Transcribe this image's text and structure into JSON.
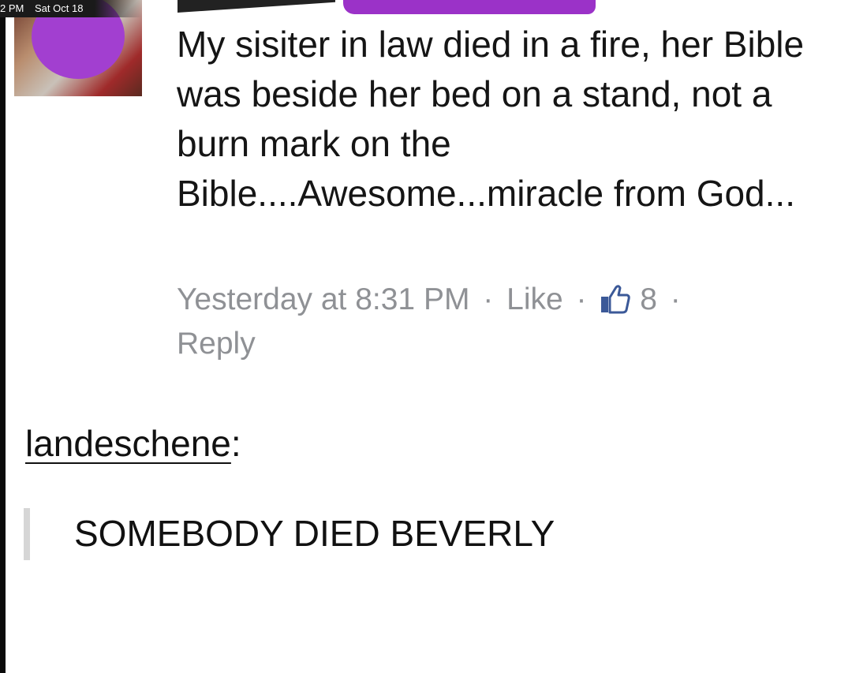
{
  "status_bar": {
    "time": "2 PM",
    "date": "Sat Oct 18"
  },
  "facebook_comment": {
    "body": "My sisiter in law died in a fire, her Bible was beside her bed on a stand, not a burn mark on the Bible....Awesome...miracle from God...",
    "timestamp": "Yesterday at 8:31 PM",
    "separator": "·",
    "like_label": "Like",
    "like_count": "8",
    "reply_label": "Reply",
    "icons": {
      "like": "thumbs-up-icon"
    },
    "colors": {
      "meta_text": "#8f9195",
      "redaction": "#9b32c8"
    }
  },
  "tumblr_post": {
    "username": "landeschene",
    "username_suffix": ":",
    "quote": "SOMEBODY DIED BEVERLY"
  }
}
